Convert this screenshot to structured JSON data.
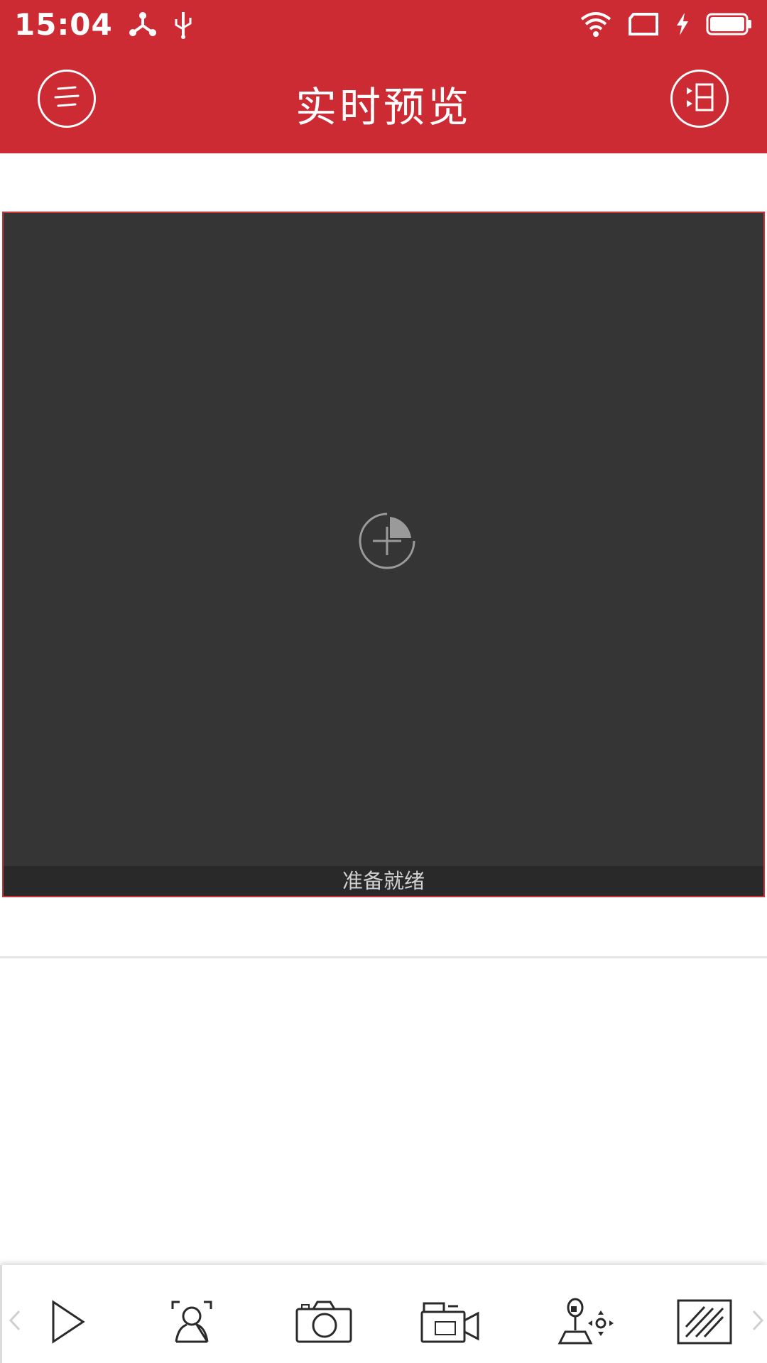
{
  "status_bar": {
    "time": "15:04",
    "icons": [
      "network-hub-icon",
      "usb-icon",
      "wifi-icon",
      "screen-rotate-icon",
      "charging-icon",
      "battery-icon"
    ]
  },
  "header": {
    "title": "实时预览",
    "left_icon": "menu-icon",
    "right_icon": "channel-list-icon",
    "background": "#cc2b33"
  },
  "preview": {
    "status_text": "准备就绪",
    "add_icon": "add-camera-icon",
    "border_color": "#c9353b"
  },
  "toolbar": {
    "items": [
      {
        "icon": "play-icon"
      },
      {
        "icon": "face-detect-icon"
      },
      {
        "icon": "snapshot-camera-icon"
      },
      {
        "icon": "record-video-icon"
      },
      {
        "icon": "ptz-joystick-icon"
      },
      {
        "icon": "image-quality-icon"
      }
    ],
    "prev_icon": "chevron-left-icon",
    "next_icon": "chevron-right-icon"
  }
}
